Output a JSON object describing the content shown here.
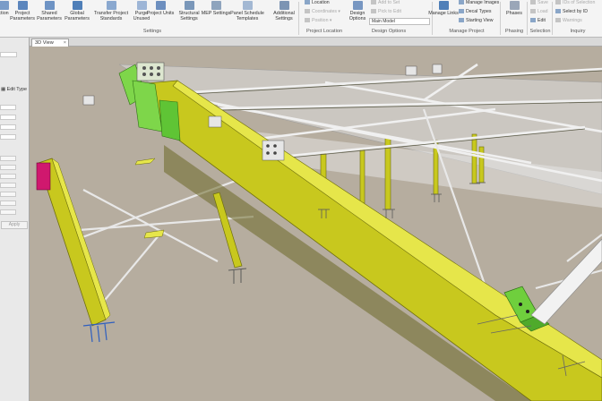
{
  "ribbon": {
    "buttons": [
      {
        "label": "ction",
        "icon": "snap-icon"
      },
      {
        "label": "Project Parameters",
        "icon": "project-parameters-icon"
      },
      {
        "label": "Shared Parameters",
        "icon": "shared-parameters-icon"
      },
      {
        "label": "Global Parameters",
        "icon": "global-parameters-icon"
      },
      {
        "label": "Transfer Project Standards",
        "icon": "transfer-standards-icon"
      },
      {
        "label": "Purge Unused",
        "icon": "purge-icon"
      },
      {
        "label": "Project Units",
        "icon": "units-icon"
      },
      {
        "label": "Structural Settings",
        "icon": "structural-settings-icon"
      },
      {
        "label": "MEP Settings",
        "icon": "mep-settings-icon"
      },
      {
        "label": "Panel Schedule Templates",
        "icon": "panel-schedule-icon"
      },
      {
        "label": "Additional Settings",
        "icon": "additional-settings-icon"
      },
      {
        "label": "Design Options",
        "icon": "design-options-icon"
      },
      {
        "label": "Manage Links",
        "icon": "manage-links-icon"
      },
      {
        "label": "Phases",
        "icon": "phases-icon"
      }
    ],
    "small": {
      "location": "Location",
      "coordinates": "Coordinates",
      "position": "Position",
      "add_to_set": "Add to Set",
      "pick_to_edit": "Pick to Edit",
      "main_model": "Main Model",
      "manage_images": "Manage Images",
      "decal_types": "Decal Types",
      "starting_view": "Starting View",
      "save": "Save",
      "load": "Load",
      "edit": "Edit",
      "ids_of_selection": "IDs of Selection",
      "select_by_id": "Select by ID",
      "warnings": "Warnings"
    },
    "groups": {
      "settings": "Settings",
      "project_location": "Project Location",
      "design_options": "Design Options",
      "manage_project": "Manage Project",
      "phasing": "Phasing",
      "selection": "Selection",
      "inquiry": "Inquiry"
    },
    "colors": {
      "ribbon_bg": "#f4f4f4",
      "icon_blue": "#4f7fb8"
    }
  },
  "properties": {
    "edit_type": "Edit Type",
    "apply": "Apply"
  },
  "view": {
    "tab_label": "3D View",
    "colors": {
      "background": "#b4ab9e",
      "steel": "#c8c81e",
      "selected": "#7ed64a",
      "cladding": "#ffffff"
    }
  }
}
